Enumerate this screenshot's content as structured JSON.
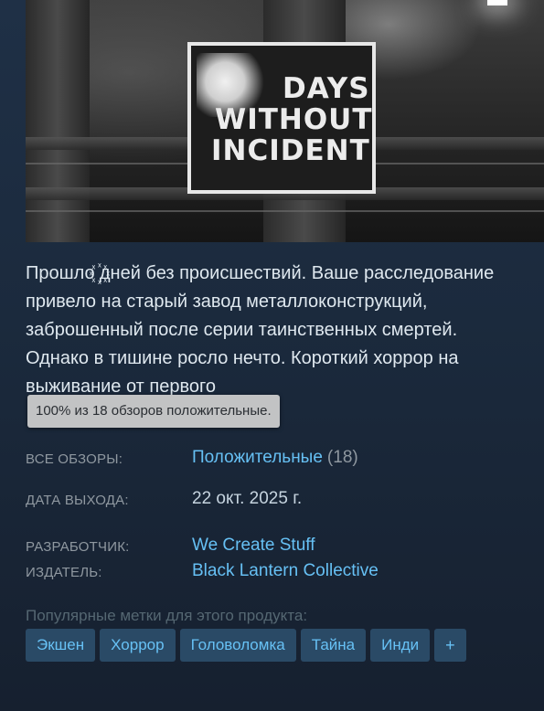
{
  "capsule": {
    "logo_lines": [
      "DAYS",
      "WITHOUT",
      "INCIDENT"
    ]
  },
  "description": {
    "before": "Прошло ",
    "glitch": "꙰꙰",
    "after": "дней без происшествий. Ваше расследование привело на старый завод металлоконструкций, заброшенный после серии таинственных смертей. Однако в тишине росло нечто. Короткий хоррор на выживание от первого"
  },
  "tooltip": {
    "text": "100% из 18 обзоров положительные."
  },
  "reviews": {
    "label": "ВСЕ ОБЗОРЫ:",
    "summary": "Положительные",
    "count": "(18)"
  },
  "release": {
    "label": "ДАТА ВЫХОДА:",
    "date": "22 окт. 2025 г."
  },
  "developer": {
    "label": "РАЗРАБОТЧИК:",
    "name": "We Create Stuff"
  },
  "publisher": {
    "label": "ИЗДАТЕЛЬ:",
    "name": "Black Lantern Collective"
  },
  "tags": {
    "label": "Популярные метки для этого продукта:",
    "items": [
      "Экшен",
      "Хоррор",
      "Головоломка",
      "Тайна",
      "Инди"
    ],
    "add_label": "+"
  },
  "colors": {
    "link": "#66c0f4",
    "tag_bg": "#2a4a66",
    "label": "#8f98a0"
  }
}
